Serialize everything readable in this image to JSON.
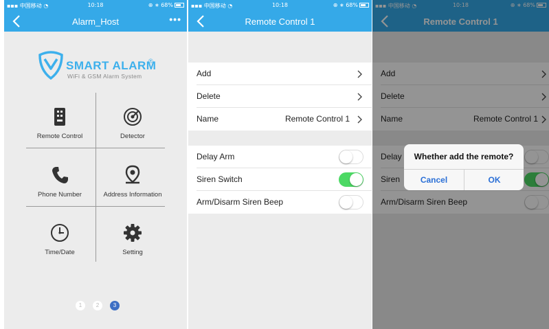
{
  "status": {
    "carrier": "中国移动",
    "time": "10:18",
    "battery": "68%",
    "battery_level": 0.68
  },
  "screen1": {
    "title": "Alarm_Host",
    "more": "•••",
    "logo": {
      "brand": "SMART ALARM",
      "reg": "®",
      "sub": "WiFi & GSM Alarm System"
    },
    "tiles": [
      {
        "label": "Remote Control",
        "icon": "remote-control-icon"
      },
      {
        "label": "Detector",
        "icon": "detector-icon"
      },
      {
        "label": "Phone Number",
        "icon": "phone-icon"
      },
      {
        "label": "Address Information",
        "icon": "location-pin-icon"
      },
      {
        "label": "Time/Date",
        "icon": "clock-icon"
      },
      {
        "label": "Setting",
        "icon": "gear-icon"
      }
    ],
    "pages": [
      "1",
      "2",
      "3"
    ],
    "active_page": 3
  },
  "screen2": {
    "title": "Remote Control 1",
    "rows": [
      {
        "label": "Add"
      },
      {
        "label": "Delete"
      },
      {
        "label": "Name",
        "value": "Remote Control 1"
      }
    ],
    "toggles": [
      {
        "label": "Delay Arm",
        "on": false
      },
      {
        "label": "Siren Switch",
        "on": true
      },
      {
        "label": "Arm/Disarm Siren Beep",
        "on": false
      }
    ]
  },
  "screen3": {
    "title": "Remote Control 1",
    "rows": [
      {
        "label": "Add"
      },
      {
        "label": "Delete"
      },
      {
        "label": "Name",
        "value": "Remote Control 1"
      }
    ],
    "toggles": [
      {
        "label": "Delay",
        "on": false
      },
      {
        "label": "Siren",
        "on": true
      },
      {
        "label": "Arm/Disarm Siren Beep",
        "on": false
      }
    ],
    "dialog": {
      "message": "Whether add the remote?",
      "cancel": "Cancel",
      "ok": "OK"
    }
  },
  "colors": {
    "header": "#35a9e8",
    "brand": "#3db0ec",
    "toggle_on": "#4cd964",
    "dialog_button": "#2a6fd6",
    "page_dot_active": "#3d6fc4"
  }
}
